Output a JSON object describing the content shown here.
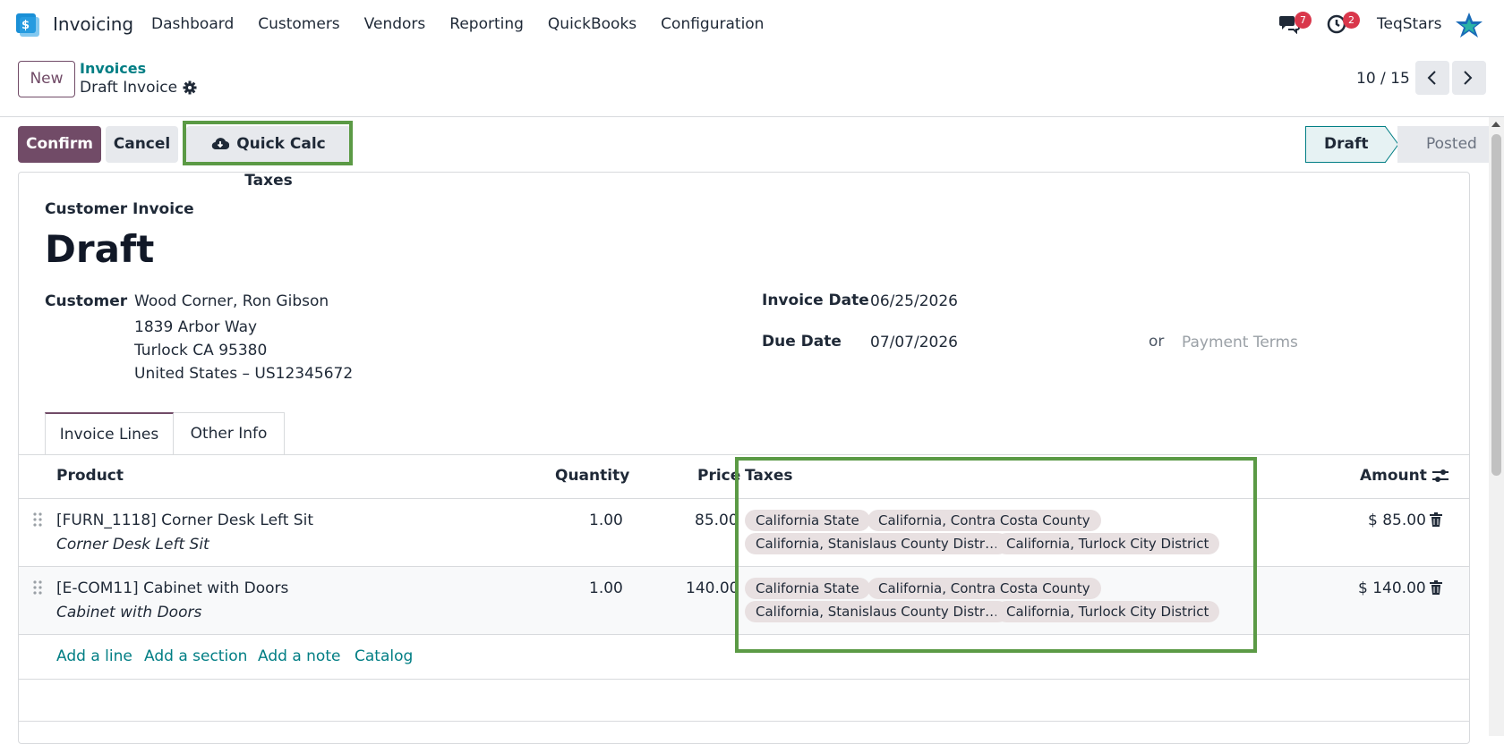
{
  "nav": {
    "app_name": "Invoicing",
    "menu": [
      "Dashboard",
      "Customers",
      "Vendors",
      "Reporting",
      "QuickBooks",
      "Configuration"
    ],
    "messages_count": "7",
    "activities_count": "2",
    "user": "TeqStars"
  },
  "control": {
    "new_label": "New",
    "breadcrumb_parent": "Invoices",
    "breadcrumb_current": "Draft Invoice",
    "pager": "10 / 15"
  },
  "actions": {
    "confirm": "Confirm",
    "cancel": "Cancel",
    "quick_calc": "Quick Calc Taxes",
    "status_draft": "Draft",
    "status_posted": "Posted"
  },
  "invoice": {
    "type": "Customer Invoice",
    "title": "Draft",
    "customer_label": "Customer",
    "customer_name": "Wood Corner, Ron Gibson",
    "address1": "1839 Arbor Way",
    "address2": "Turlock CA 95380",
    "address3": "United States – US12345672",
    "invoice_date_label": "Invoice Date",
    "invoice_date": "06/25/2026",
    "due_date_label": "Due Date",
    "due_date": "07/07/2026",
    "or": "or",
    "payment_terms_placeholder": "Payment Terms"
  },
  "tabs": [
    "Invoice Lines",
    "Other Info"
  ],
  "table": {
    "headers": {
      "product": "Product",
      "quantity": "Quantity",
      "price": "Price",
      "taxes": "Taxes",
      "amount": "Amount"
    },
    "rows": [
      {
        "product": "[FURN_1118] Corner Desk Left Sit",
        "description": "Corner Desk Left Sit",
        "quantity": "1.00",
        "price": "85.00",
        "taxes": [
          "California State",
          "California, Contra Costa County",
          "California, Stanislaus County Distr…",
          "California, Turlock City District"
        ],
        "amount": "$ 85.00"
      },
      {
        "product": "[E-COM11] Cabinet with Doors",
        "description": "Cabinet with Doors",
        "quantity": "1.00",
        "price": "140.00",
        "taxes": [
          "California State",
          "California, Contra Costa County",
          "California, Stanislaus County Distr…",
          "California, Turlock City District"
        ],
        "amount": "$ 140.00"
      }
    ],
    "add_links": [
      "Add a line",
      "Add a section",
      "Add a note",
      "Catalog"
    ]
  },
  "colors": {
    "primary": "#714b67",
    "teal": "#017e84",
    "highlight": "#5b9a45",
    "badge": "#d9374b"
  }
}
